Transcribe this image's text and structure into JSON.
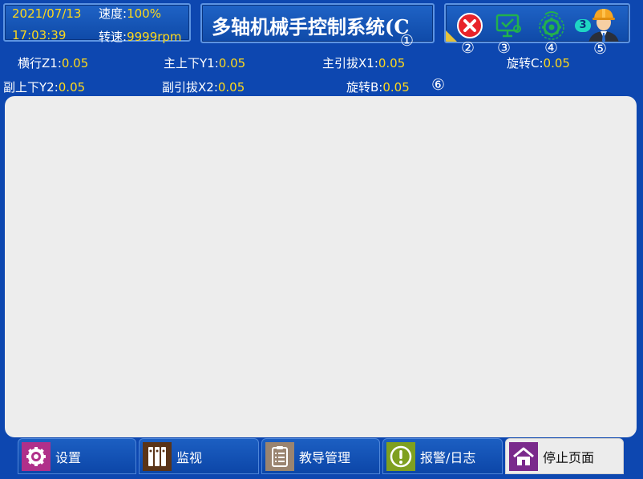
{
  "status": {
    "date": "2021/07/13",
    "time": "17:03:39",
    "speed_label": "速度:",
    "speed_value": "100%",
    "rpm_label": "转速:",
    "rpm_value": "9999rpm"
  },
  "header": {
    "title": "多轴机械手控制系统(C"
  },
  "markers": {
    "m1": "①",
    "m2": "②",
    "m3": "③",
    "m4": "④",
    "m5": "⑤",
    "m6": "⑥"
  },
  "toolbar": {
    "close_icon": "close-icon",
    "monitor_icon": "monitor-check-icon",
    "gear_icon": "gear-icon",
    "user_icon": "operator-icon",
    "user_level": "3",
    "colors": {
      "close": "#e8232a",
      "green": "#22b14c",
      "badge": "#1fd6c4",
      "helmet": "#f5a623"
    }
  },
  "axes": [
    {
      "label": "横行Z1:",
      "value": "0.05"
    },
    {
      "label": "主上下Y1:",
      "value": "0.05"
    },
    {
      "label": "主引拔X1:",
      "value": "0.05"
    },
    {
      "label": "旋转C:",
      "value": "0.05"
    },
    {
      "label": "副上下Y2:",
      "value": "0.05"
    },
    {
      "label": "副引拔X2:",
      "value": "0.05"
    },
    {
      "label": "旋转B:",
      "value": "0.05"
    }
  ],
  "nav": [
    {
      "label": "设置",
      "icon": "settings-icon",
      "color": "#b0308a"
    },
    {
      "label": "监视",
      "icon": "monitor-icon",
      "color": "#5a3418"
    },
    {
      "label": "教导管理",
      "icon": "clipboard-icon",
      "color": "#9a8470"
    },
    {
      "label": "报警/日志",
      "icon": "alarm-icon",
      "color": "#7fa020"
    },
    {
      "label": "停止页面",
      "icon": "home-icon",
      "color": "#7a2a8c"
    }
  ],
  "theme": {
    "background": "#0d47b0",
    "value_color": "#ffd91a",
    "content_bg": "#ededed"
  }
}
